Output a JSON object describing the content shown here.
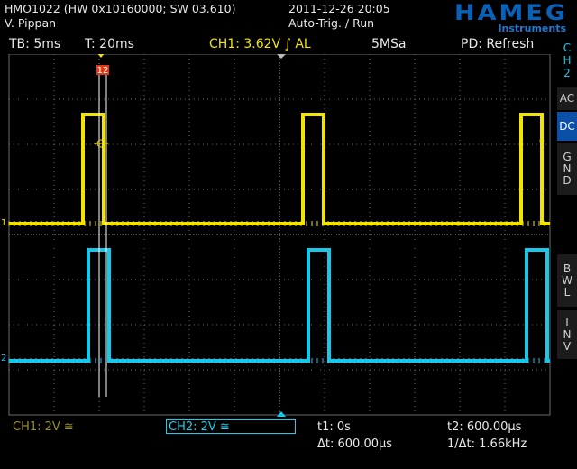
{
  "header": {
    "device": "HMO1022 (HW 0x10160000; SW 03.610)",
    "user": "V. Pippan",
    "datetime": "2011-12-26 20:05",
    "trigger_mode": "Auto-Trig. / Run",
    "brand": "HAMEG",
    "brand_sub": "Instruments"
  },
  "status": {
    "timebase": "TB: 5ms",
    "trigger_time": "T: 20ms",
    "ch1_trigger": "CH1: 3.62V ∫ AL",
    "sample_rate": "5MSa",
    "peak_detect": "PD: Refresh"
  },
  "side_panel": {
    "channel": "C\nH\n2",
    "ac": "AC",
    "dc": "DC",
    "gnd": "G\nN\nD",
    "bwl": "B\nW\nL",
    "inv": "I\nN\nV"
  },
  "markers": {
    "cursor_tag": "12",
    "ch1_ground": "1",
    "ch2_ground": "2",
    "trigger_level": "T"
  },
  "bottom": {
    "ch1_scale": "CH1: 2V ≅",
    "ch2_scale": "CH2: 2V ≅",
    "t1": "t1: 0s",
    "t2": "t2: 600.00µs",
    "delta_t": "Δt: 600.00µs",
    "inv_delta_t": "1/Δt: 1.66kHz"
  },
  "colors": {
    "ch1": "#f2e400",
    "ch2": "#19c8e8",
    "grid": "#6a6a6a",
    "accent": "#0a4fa8"
  },
  "waveforms": {
    "time_per_div_ms": 5,
    "ch1_volts_per_div": 2,
    "ch2_volts_per_div": 2,
    "pulse_width_ms": 2.3,
    "pulse_starts_ms": [
      8.2,
      32.6,
      56.8
    ],
    "ch2_delay_ms": 0.6
  }
}
